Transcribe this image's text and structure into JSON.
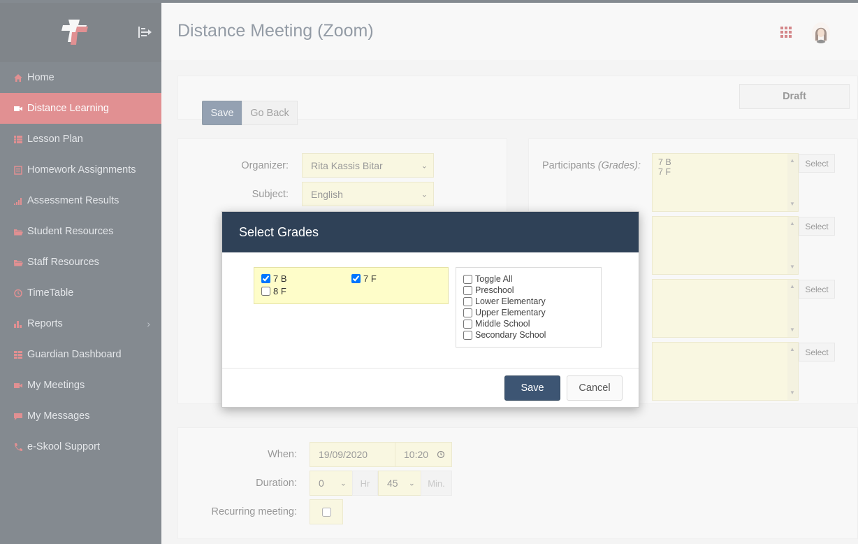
{
  "header": {
    "title": "Distance Meeting (Zoom)"
  },
  "sidebar": {
    "items": [
      {
        "label": "Home",
        "icon": "home-icon",
        "active": false
      },
      {
        "label": "Distance Learning",
        "icon": "video-icon",
        "active": true
      },
      {
        "label": "Lesson Plan",
        "icon": "list-icon",
        "active": false
      },
      {
        "label": "Homework Assignments",
        "icon": "homework-icon",
        "active": false
      },
      {
        "label": "Assessment Results",
        "icon": "bar-signal-icon",
        "active": false
      },
      {
        "label": "Student Resources",
        "icon": "folder-open-icon",
        "active": false
      },
      {
        "label": "Staff Resources",
        "icon": "folder-open-icon",
        "active": false
      },
      {
        "label": "TimeTable",
        "icon": "clock-icon",
        "active": false
      },
      {
        "label": "Reports",
        "icon": "bar-chart-icon",
        "active": false
      },
      {
        "label": "Guardian Dashboard",
        "icon": "grid-icon",
        "active": false
      },
      {
        "label": "My Meetings",
        "icon": "video-icon",
        "active": false
      },
      {
        "label": "My Messages",
        "icon": "message-icon",
        "active": false
      },
      {
        "label": "e-Skool Support",
        "icon": "phone-icon",
        "active": false
      }
    ]
  },
  "toolbar": {
    "save_label": "Save",
    "back_label": "Go Back",
    "draft_label": "Draft"
  },
  "form": {
    "organizer_label": "Organizer:",
    "organizer_value": "Rita Kassis Bitar",
    "subject_label": "Subject:",
    "subject_value": "English",
    "participants_label": "Participants",
    "participants_hint": "(Grades):",
    "participants_value_1": "7 B",
    "participants_value_2": "7 F",
    "select_label": "Select",
    "when_label": "When:",
    "date_value": "19/09/2020",
    "time_value": "10:20",
    "duration_label": "Duration:",
    "hours_value": "0",
    "hours_unit": "Hr",
    "minutes_value": "45",
    "minutes_unit": "Min.",
    "recurring_label": "Recurring meeting:"
  },
  "modal": {
    "title": "Select Grades",
    "grades": [
      {
        "label": "7 B",
        "checked": true
      },
      {
        "label": "7 F",
        "checked": true
      },
      {
        "label": "8 F",
        "checked": false
      }
    ],
    "levels": [
      {
        "label": "Toggle All",
        "checked": false
      },
      {
        "label": "Preschool",
        "checked": false
      },
      {
        "label": "Lower Elementary",
        "checked": false
      },
      {
        "label": "Upper Elementary",
        "checked": false
      },
      {
        "label": "Middle School",
        "checked": false
      },
      {
        "label": "Secondary School",
        "checked": false
      }
    ],
    "save_label": "Save",
    "cancel_label": "Cancel"
  },
  "colors": {
    "sidebar_bg": "#1f2a36",
    "active_item": "#c8363a",
    "primary_button": "#3d5573",
    "modal_header": "#2f4157",
    "field_yellow": "#f4f0c8"
  }
}
